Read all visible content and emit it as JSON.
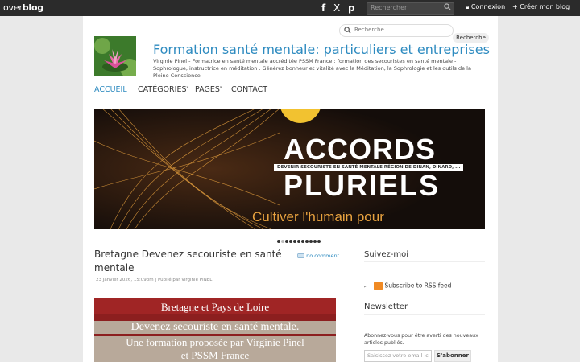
{
  "overblog": {
    "logo_light": "over",
    "logo_bold": "blog",
    "social": [
      {
        "icon": "facebook-icon",
        "glyph": "f"
      },
      {
        "icon": "x-icon",
        "glyph": "X"
      },
      {
        "icon": "pinterest-icon",
        "glyph": "p"
      }
    ],
    "search_placeholder": "Rechercher",
    "login": "Connexion",
    "create_blog": "Créer mon blog"
  },
  "blog": {
    "title": "Formation santé mentale: particuliers et entreprises",
    "description": "Virginie Pinel - Formatrice en santé mentale accréditée PSSM France : formation des secouristes en santé mentale - Sophrologue, instructrice en méditation . Générez bonheur et vitalité avec la Méditation, la Sophrologie et les outils de la Pleine Conscience",
    "search_placeholder": "Recherche...",
    "search_button": "Recherche"
  },
  "nav": {
    "items": [
      {
        "label": "ACCUEIL",
        "active": true
      },
      {
        "label": "CATÉGORIES",
        "has_submenu": true
      },
      {
        "label": "PAGES",
        "has_submenu": true
      },
      {
        "label": "CONTACT"
      }
    ]
  },
  "slider": {
    "title_line1": "ACCORDS",
    "title_line2": "PLURIELS",
    "caption": "DEVENIR SECOURISTE EN SANTÉ MENTALE RÉGION DE DINAN, DINARD, ...",
    "subtitle": "Cultiver l'humain pour",
    "dot_count": 11,
    "active_dot": 1
  },
  "post": {
    "title": "Bretagne Devenez secouriste en santé mentale",
    "comments": "no comment",
    "meta": "23 Janvier 2026, 15:09pm | Publié par Virginie PINEL",
    "image_lines": [
      "Bretagne et Pays de Loire",
      "Devenez secouriste en santé mentale.",
      "Une formation proposée par Virginie Pinel",
      "et PSSM France"
    ]
  },
  "sidebar": {
    "follow_title": "Suivez-moi",
    "rss_label": "Subscribe to RSS feed",
    "newsletter_title": "Newsletter",
    "newsletter_desc": "Abonnez-vous pour être averti des nouveaux articles publiés.",
    "email_placeholder": "Saisissez votre email ici",
    "subscribe_button": "S'abonner"
  },
  "colors": {
    "accent": "#2e8bc0",
    "topbar": "#2b2b2b",
    "slide_bg": "#1b1410",
    "slide_accent": "#e8a23f",
    "post_image_bg": "#8c1f1f"
  }
}
